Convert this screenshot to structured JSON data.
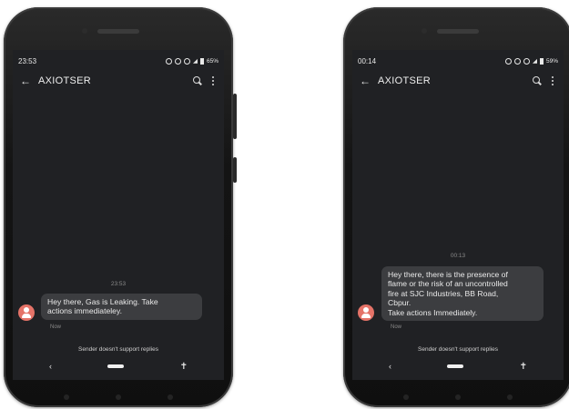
{
  "phones": [
    {
      "status_time": "23:53",
      "battery": "65%",
      "title": "AXIOTSER",
      "message_time": "23:53",
      "message_lines": [
        "Hey there, Gas is Leaking. Take",
        "actions immediateley."
      ],
      "message_meta": "Now",
      "no_reply": "Sender doesn't support replies"
    },
    {
      "status_time": "00:14",
      "battery": "59%",
      "title": "AXIOTSER",
      "message_time": "00:13",
      "message_lines": [
        "Hey there, there is the presence of",
        "flame or the risk of an uncontrolled",
        "fire at SJC Industries, BB Road,",
        "Cbpur.",
        "Take actions Immediately."
      ],
      "message_meta": "Now",
      "no_reply": "Sender doesn't support replies"
    }
  ],
  "colors": {
    "screen_bg": "#202124",
    "bubble_bg": "#3c3d40",
    "avatar": "#e57368"
  },
  "icons": [
    "back-arrow-icon",
    "search-icon",
    "more-options-icon",
    "contact-avatar-icon",
    "nav-back-icon",
    "nav-home-icon",
    "accessibility-icon"
  ]
}
